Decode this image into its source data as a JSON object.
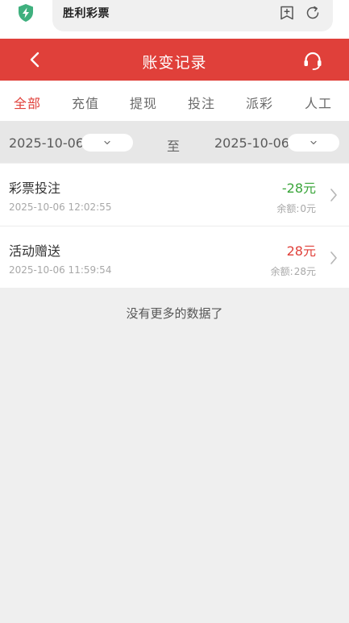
{
  "browser": {
    "site_title": "胜利彩票",
    "shield_icon": "shield-bolt-icon",
    "bookmark_icon": "bookmark-add-icon",
    "refresh_icon": "refresh-icon"
  },
  "header": {
    "title": "账变记录",
    "back_icon": "back-arrow-icon",
    "support_icon": "headset-icon",
    "color": "#e0403a"
  },
  "tabs": [
    {
      "label": "全部",
      "active": true
    },
    {
      "label": "充值",
      "active": false
    },
    {
      "label": "提现",
      "active": false
    },
    {
      "label": "投注",
      "active": false
    },
    {
      "label": "派彩",
      "active": false
    },
    {
      "label": "人工",
      "active": false
    }
  ],
  "date_range": {
    "start": "2025-10-06",
    "separator": "至",
    "end": "2025-10-06"
  },
  "records": [
    {
      "type": "彩票投注",
      "time": "2025-10-06 12:02:55",
      "amount": "-28元",
      "balance_label": "余额:",
      "balance": "0元",
      "amount_color": "#3aa53a"
    },
    {
      "type": "活动赠送",
      "time": "2025-10-06 11:59:54",
      "amount": "28元",
      "balance_label": "余额:",
      "balance": "28元",
      "amount_color": "#e0403a"
    }
  ],
  "footer_text": "没有更多的数据了"
}
